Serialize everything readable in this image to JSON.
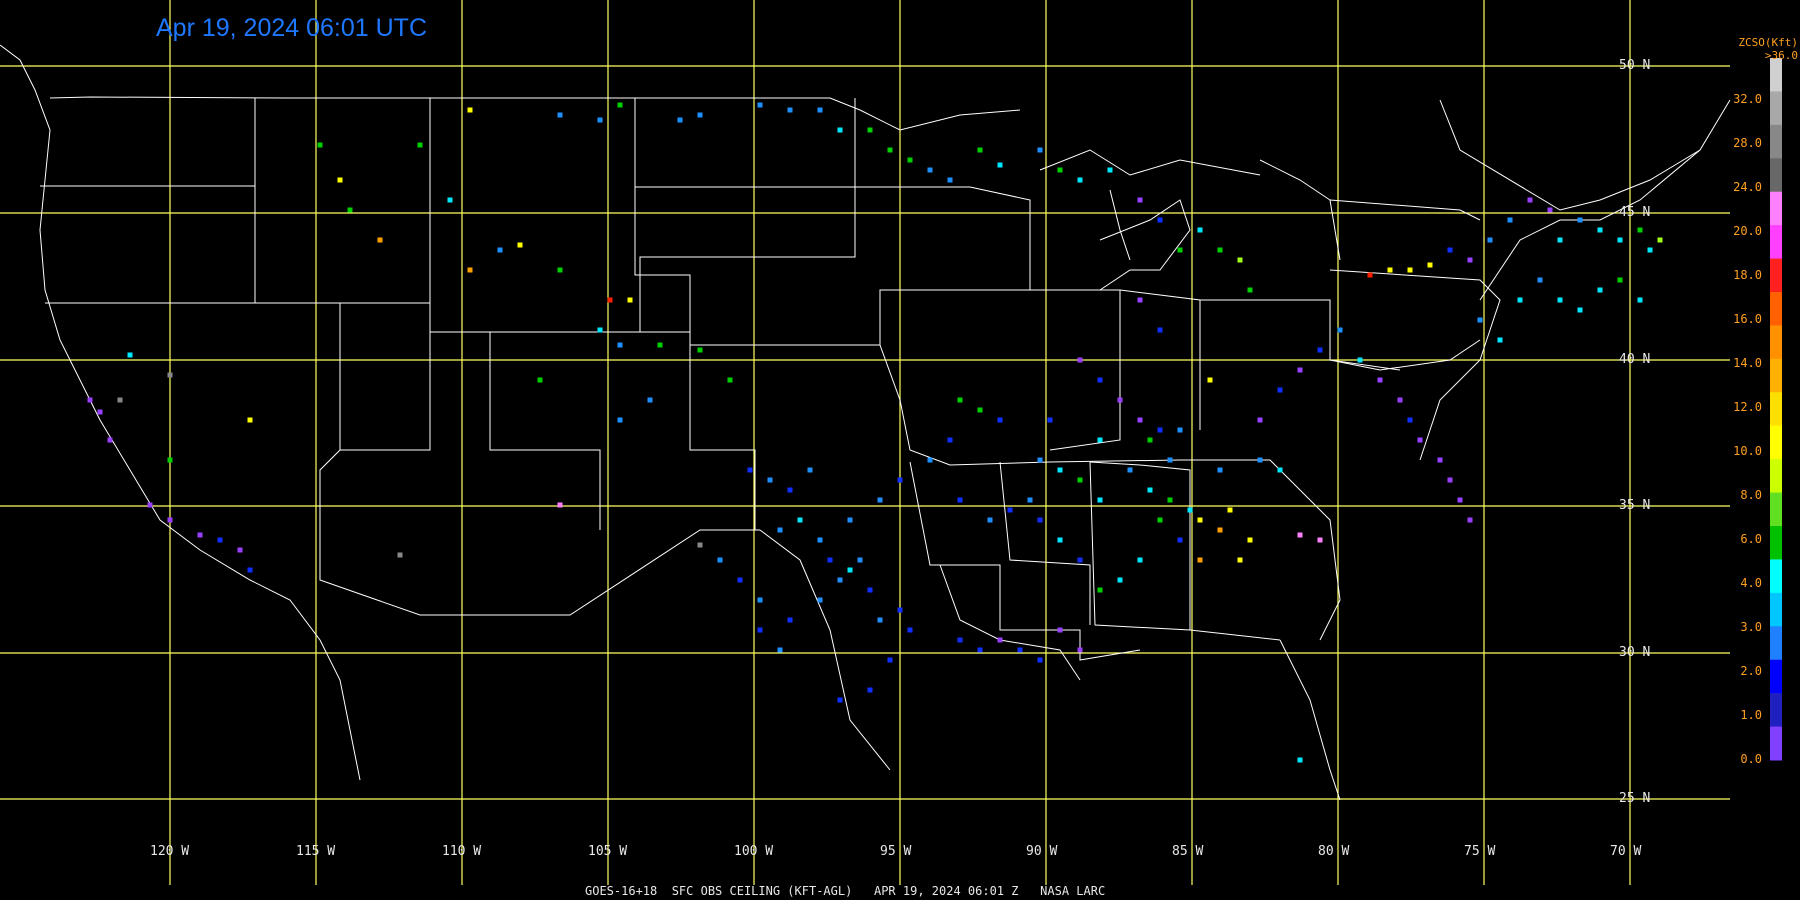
{
  "title": "Apr 19, 2024 06:01 UTC",
  "footer": "GOES-16+18  SFC OBS CEILING (KFT-AGL)   APR 19, 2024 06:01 Z   NASA LARC",
  "colorbar": {
    "title_line1": "ZCSO(Kft)",
    "title_line2": ">36.0",
    "labels": [
      "32.0",
      "28.0",
      "24.0",
      "20.0",
      "18.0",
      "16.0",
      "14.0",
      "12.0",
      "10.0",
      "8.0",
      "6.0",
      "4.0",
      "3.0",
      "2.0",
      "1.0",
      "0.0"
    ],
    "swatches": [
      "#d0d0d0",
      "#a8a8a8",
      "#888888",
      "#686868",
      "#ff80ff",
      "#ff40ff",
      "#ff2020",
      "#ff6000",
      "#ff9000",
      "#ffb000",
      "#ffe000",
      "#ffff00",
      "#ccff00",
      "#60e020",
      "#00c000",
      "#00ffff",
      "#00c8ff",
      "#2080ff",
      "#0000ff",
      "#2020c0",
      "#8040ff"
    ]
  },
  "lat_labels": [
    "50 N",
    "45 N",
    "40 N",
    "35 N",
    "30 N",
    "25 N"
  ],
  "lon_labels": [
    "120 W",
    "115 W",
    "110 W",
    "105 W",
    "100 W",
    "95 W",
    "90 W",
    "85 W",
    "80 W",
    "75 W",
    "70 W"
  ],
  "grid_color": "#ffff60",
  "border_color": "#ffffff",
  "station_colors": {
    "purple": "#9a40ff",
    "blue": "#1030ff",
    "lightblue": "#1e90ff",
    "cyan": "#00e8ff",
    "green": "#00d000",
    "yellowgreen": "#a0ff20",
    "yellow": "#ffff00",
    "orange": "#ffa000",
    "red": "#ff2000",
    "pink": "#ff80ff",
    "gray": "#888888"
  }
}
